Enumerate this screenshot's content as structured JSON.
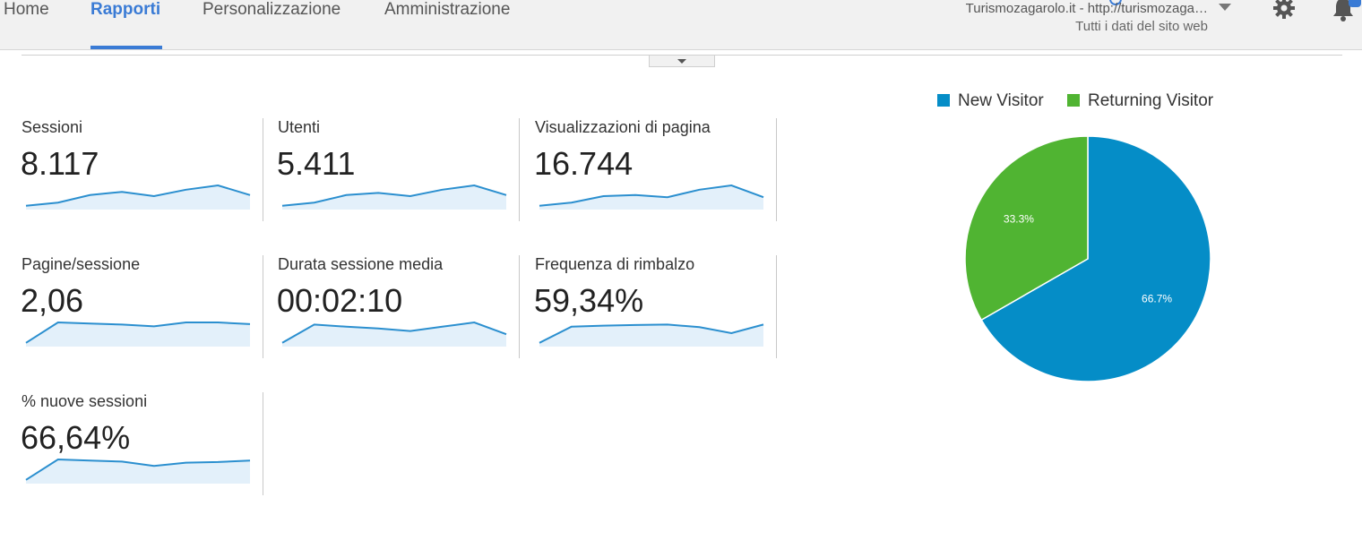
{
  "nav": {
    "tabs": [
      {
        "label": "Home",
        "active": false
      },
      {
        "label": "Rapporti",
        "active": true
      },
      {
        "label": "Personalizzazione",
        "active": false
      },
      {
        "label": "Amministrazione",
        "active": false
      }
    ]
  },
  "account": {
    "property": "Turismozagarolo.it - http://turismozaga…",
    "view": "Tutti i dati del sito web"
  },
  "icons": {
    "gear": "gear-icon",
    "bell": "bell-icon",
    "collapse": "chevron-down-icon"
  },
  "colors": {
    "accent": "#3a7bd5",
    "sparkline": "#2b8fcf",
    "sparkline_fill": "#e3f0fa",
    "new_visitor": "#058dc7",
    "returning_visitor": "#50b432"
  },
  "metrics": [
    {
      "label": "Sessioni",
      "value": "8.117",
      "trend": [
        0.05,
        0.2,
        0.55,
        0.7,
        0.5,
        0.8,
        1.0,
        0.55
      ]
    },
    {
      "label": "Utenti",
      "value": "5.411",
      "trend": [
        0.05,
        0.2,
        0.55,
        0.65,
        0.5,
        0.8,
        1.0,
        0.55
      ]
    },
    {
      "label": "Visualizzazioni di pagina",
      "value": "16.744",
      "trend": [
        0.05,
        0.2,
        0.5,
        0.55,
        0.45,
        0.8,
        1.0,
        0.45
      ]
    },
    {
      "label": "Pagine/sessione",
      "value": "2,06",
      "trend": [
        0.05,
        1.0,
        0.95,
        0.9,
        0.82,
        1.0,
        1.0,
        0.92
      ]
    },
    {
      "label": "Durata sessione media",
      "value": "00:02:10",
      "trend": [
        0.05,
        0.9,
        0.8,
        0.72,
        0.6,
        0.8,
        1.0,
        0.45
      ]
    },
    {
      "label": "Frequenza di rimbalzo",
      "value": "59,34%",
      "trend": [
        0.05,
        0.8,
        0.85,
        0.88,
        0.9,
        0.78,
        0.5,
        0.9
      ]
    },
    {
      "label": "% nuove sessioni",
      "value": "66,64%",
      "trend": [
        0.05,
        1.0,
        0.95,
        0.9,
        0.7,
        0.85,
        0.88,
        0.95
      ]
    }
  ],
  "chart_data": {
    "type": "pie",
    "series": [
      {
        "name": "New Visitor",
        "value": 66.7,
        "label": "66.7%",
        "color": "#058dc7"
      },
      {
        "name": "Returning Visitor",
        "value": 33.3,
        "label": "33.3%",
        "color": "#50b432"
      }
    ],
    "legend_position": "top"
  }
}
